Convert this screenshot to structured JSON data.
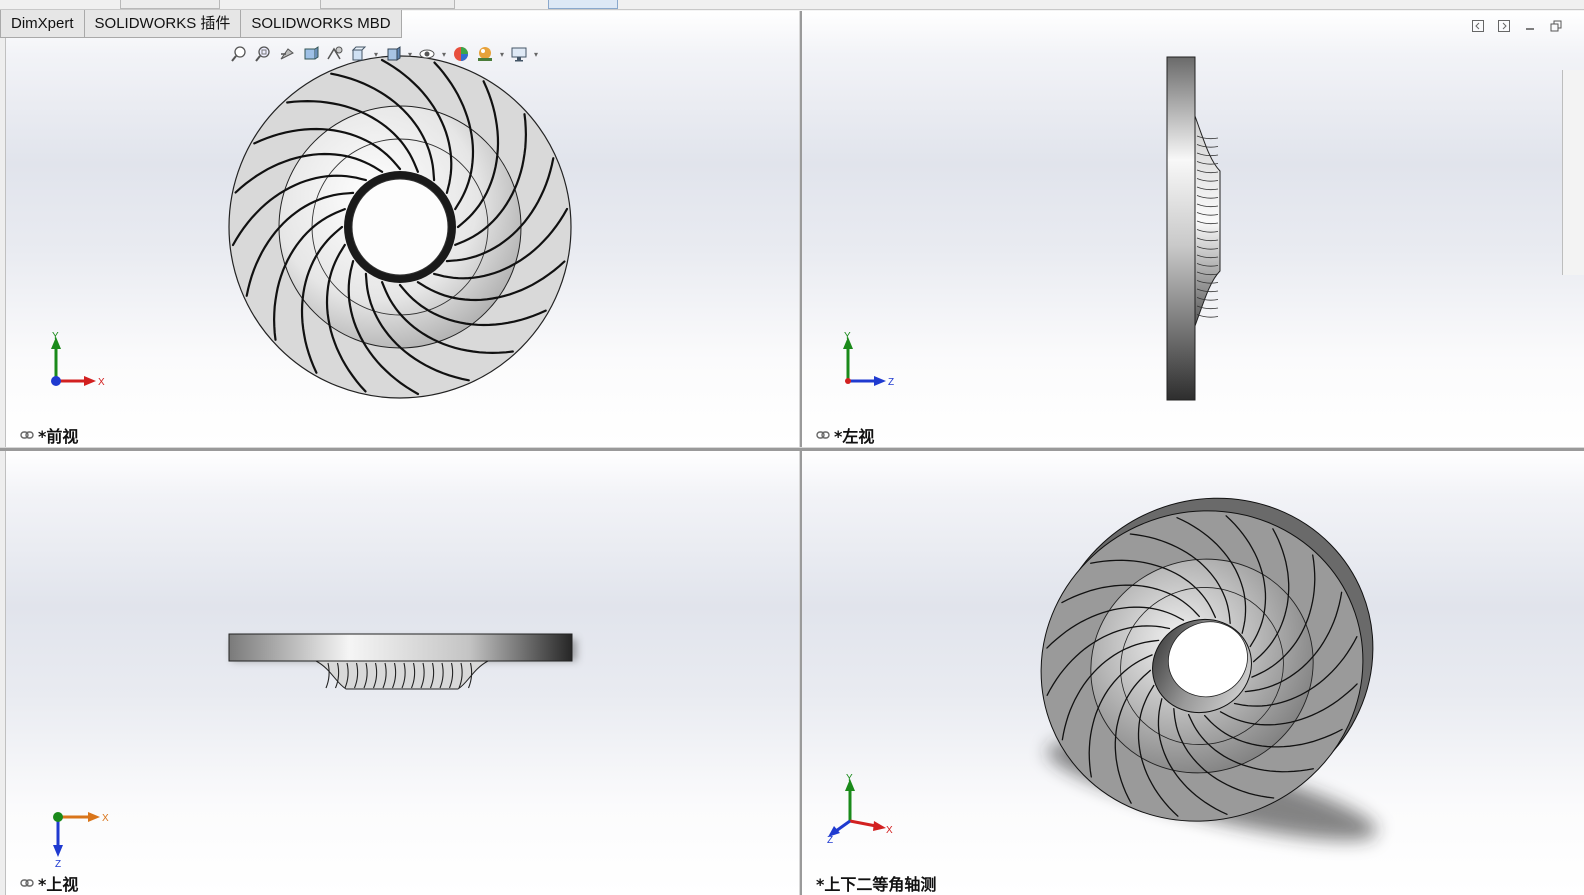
{
  "command_tabs": [
    {
      "label": "DimXpert"
    },
    {
      "label": "SOLIDWORKS 插件"
    },
    {
      "label": "SOLIDWORKS MBD"
    }
  ],
  "heads_up_toolbar": {
    "tools": [
      "zoom-to-fit-icon",
      "zoom-to-area-icon",
      "previous-view-icon",
      "section-view-icon",
      "dynamic-annotation-icon",
      "view-orientation-icon",
      "display-style-icon",
      "hide-show-items-icon",
      "edit-appearance-icon",
      "apply-scene-icon",
      "view-settings-icon"
    ]
  },
  "viewports": {
    "front": {
      "label": "*前视",
      "triad": {
        "axis1": "Y",
        "axis2": "X"
      }
    },
    "left": {
      "label": "*左视",
      "triad": {
        "axis1": "Y",
        "axis2": "Z"
      }
    },
    "top": {
      "label": "*上视",
      "triad": {
        "axis1": "X",
        "axis2": "Z"
      }
    },
    "iso": {
      "label": "*上下二等角轴测",
      "triad": {
        "axis1": "Y",
        "axis2": "X",
        "axis3": "Z"
      }
    }
  },
  "colors": {
    "axis_x": "#d22020",
    "axis_y": "#1a8a1a",
    "axis_z": "#1f3ad0",
    "part_face": "#d9d9d9",
    "edge": "#111111"
  }
}
